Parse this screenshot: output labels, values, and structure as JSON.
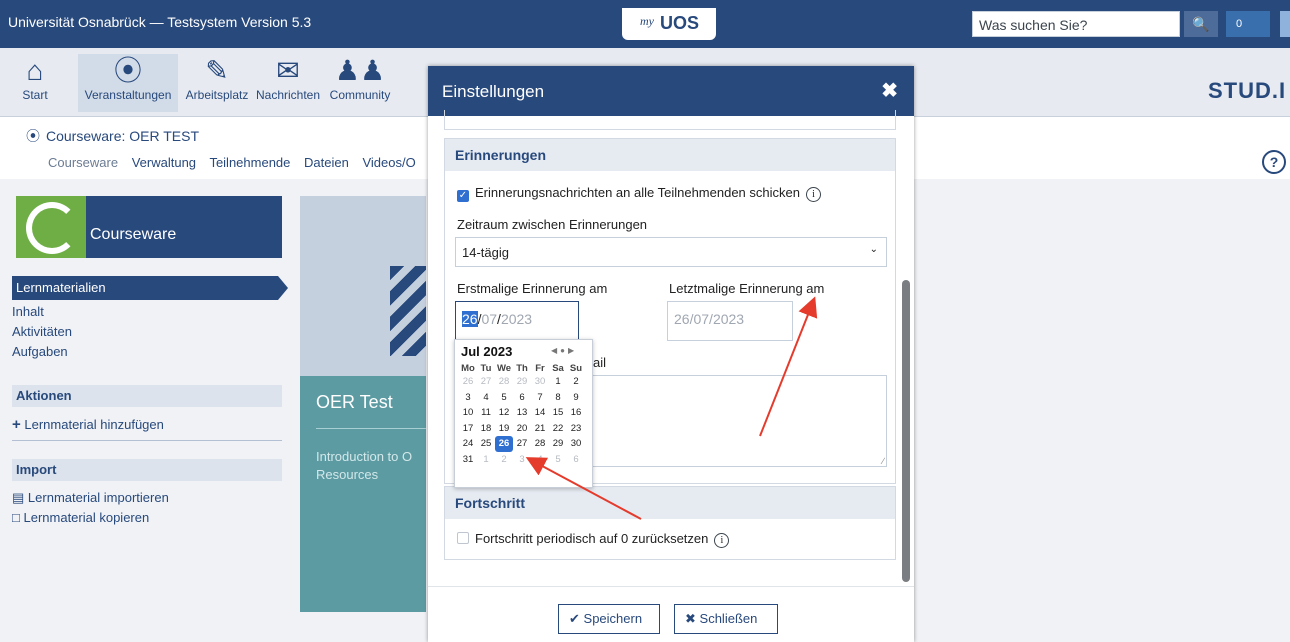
{
  "topbar": {
    "title": "Universität Osnabrück — Testsystem Version 5.3",
    "logo_my": "my",
    "logo_uos": "UOS",
    "search_placeholder": "Was suchen Sie?",
    "notification_count": "0"
  },
  "nav": {
    "items": [
      {
        "label": "Start",
        "icon": "home-icon"
      },
      {
        "label": "Veranstaltungen",
        "icon": "courses-icon"
      },
      {
        "label": "Arbeitsplatz",
        "icon": "workplace-icon"
      },
      {
        "label": "Nachrichten",
        "icon": "mail-icon"
      },
      {
        "label": "Community",
        "icon": "community-icon"
      }
    ],
    "brand": "STUD.I"
  },
  "course": {
    "title": "Courseware: OER TEST",
    "tabs": [
      "Courseware",
      "Verwaltung",
      "Teilnehmende",
      "Dateien",
      "Videos/O"
    ]
  },
  "sidebar": {
    "courseware_label": "Courseware",
    "lernmaterialien": "Lernmaterialien",
    "links": [
      "Inhalt",
      "Aktivitäten",
      "Aufgaben"
    ],
    "aktionen_title": "Aktionen",
    "aktionen_item": "Lernmaterial hinzufügen",
    "import_title": "Import",
    "import_items": [
      "Lernmaterial importieren",
      "Lernmaterial kopieren"
    ]
  },
  "card": {
    "title": "OER Test",
    "description": "Introduction to O\nResources"
  },
  "modal": {
    "title": "Einstellungen",
    "close": "✖",
    "erinnerungen_title": "Erinnerungen",
    "send_reminders_label": "Erinnerungsnachrichten an alle Teilnehmenden schicken",
    "interval_label": "Zeitraum zwischen Erinnerungen",
    "interval_value": "14-tägig",
    "first_label": "Erstmalige Erinnerung am",
    "last_label": "Letztmalige Erinnerung am",
    "first_date": {
      "day": "26",
      "month": "07",
      "year": "2023"
    },
    "last_date": {
      "day": "26",
      "month": "07",
      "year": "2023"
    },
    "mail_label_fragment": "ail",
    "fortschritt_title": "Fortschritt",
    "reset_label": "Fortschritt periodisch auf 0 zurücksetzen",
    "save_label": "Speichern",
    "close_label": "Schließen"
  },
  "datepicker": {
    "month_label": "Jul 2023",
    "weekdays": [
      "Mo",
      "Tu",
      "We",
      "Th",
      "Fr",
      "Sa",
      "Su"
    ],
    "weeks": [
      [
        "26",
        "27",
        "28",
        "29",
        "30",
        "1",
        "2"
      ],
      [
        "3",
        "4",
        "5",
        "6",
        "7",
        "8",
        "9"
      ],
      [
        "10",
        "11",
        "12",
        "13",
        "14",
        "15",
        "16"
      ],
      [
        "17",
        "18",
        "19",
        "20",
        "21",
        "22",
        "23"
      ],
      [
        "24",
        "25",
        "26",
        "27",
        "28",
        "29",
        "30"
      ],
      [
        "31",
        "1",
        "2",
        "3",
        "4",
        "5",
        "6"
      ]
    ],
    "selected": "26"
  },
  "colors": {
    "brand": "#28497c",
    "accent": "#2f6fd0",
    "annotation": "#e53b2c"
  }
}
